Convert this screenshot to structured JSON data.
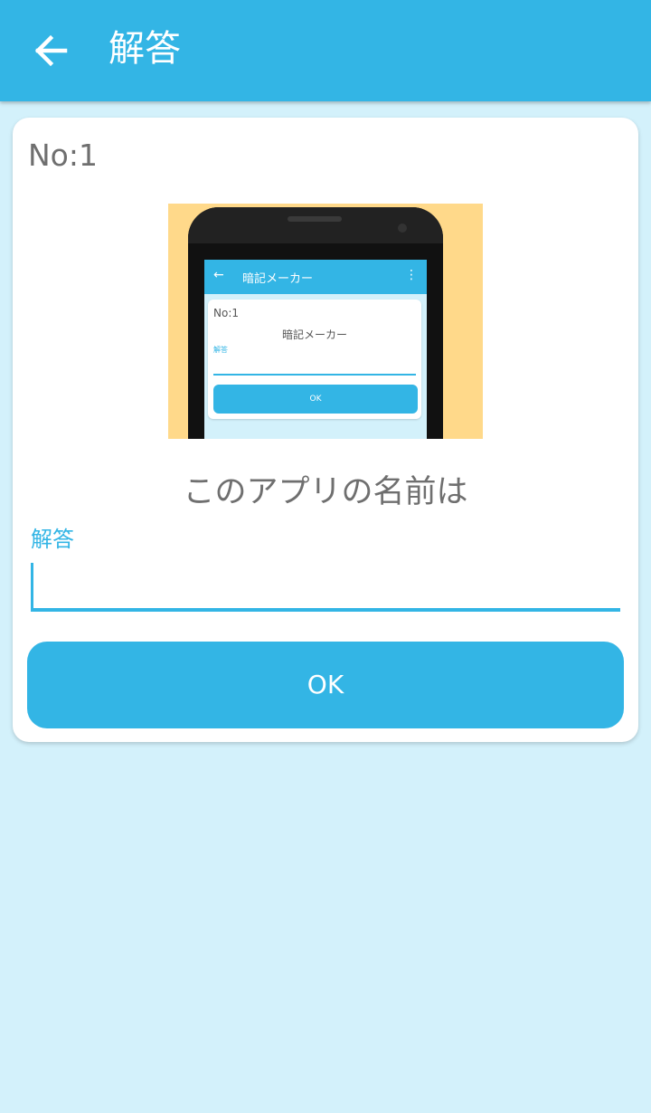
{
  "appbar": {
    "title": "解答",
    "back_icon": "arrow-left-icon"
  },
  "question": {
    "number": "No:1",
    "text": "このアプリの名前は",
    "image": {
      "app_title": "暗記メーカー",
      "number": "No:1",
      "question_text": "暗記メーカー",
      "answer_label": "解答",
      "ok_label": "OK"
    }
  },
  "answer": {
    "label": "解答",
    "value": "",
    "placeholder": ""
  },
  "ok_button": {
    "label": "OK"
  },
  "colors": {
    "accent": "#33b5e5",
    "background": "#d3f1fb",
    "card": "#ffffff",
    "text": "#6f6f6f"
  }
}
